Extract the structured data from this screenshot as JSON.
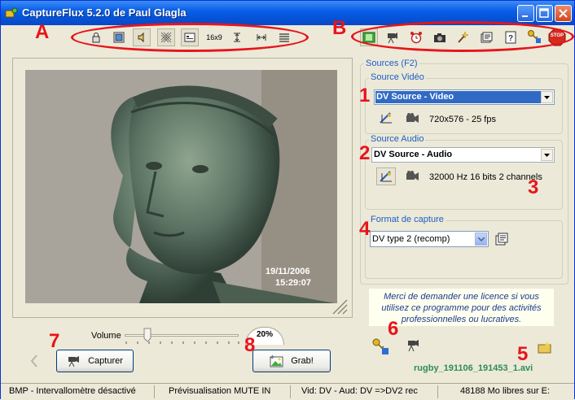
{
  "window": {
    "title": "CaptureFlux 5.2.0 de Paul Glagla"
  },
  "toolbar_a": {
    "icons": [
      "lock-icon",
      "frame-icon",
      "speaker-icon",
      "noise-icon",
      "screen-icon",
      "aspect-16x9",
      "vertical-stretch-icon",
      "horizontal-stretch-icon",
      "lines-icon"
    ],
    "aspect_label": "16x9"
  },
  "toolbar_b": {
    "icons": [
      "film-icon",
      "camera-tripod-icon",
      "alarm-clock-icon",
      "photo-camera-icon",
      "wizard-icon",
      "properties-icon",
      "help-icon",
      "license-key-icon",
      "stop-icon"
    ],
    "stop_label": "STOP"
  },
  "preview": {
    "date": "19/11/2006",
    "time": "15:29:07"
  },
  "sources": {
    "label": "Sources (F2)",
    "video": {
      "label": "Source Vidéo",
      "selected": "DV Source - Video",
      "format": "720x576 - 25 fps"
    },
    "audio": {
      "label": "Source Audio",
      "selected": "DV Source - Audio",
      "format": "32000 Hz 16 bits 2 channels"
    }
  },
  "capture_format": {
    "label": "Format de capture",
    "selected": "DV type 2 (recomp)"
  },
  "license_notice": "Merci de demander une licence si vous utilisez ce programme pour des activités professionnelles ou lucratives.",
  "output_file": "rugby_191106_191453_1.avi",
  "volume": {
    "label": "Volume",
    "percent_label": "20%",
    "level": 0.2
  },
  "buttons": {
    "capture": "Capturer",
    "grab": "Grab!"
  },
  "annotations": {
    "A": "A",
    "B": "B",
    "n1": "1",
    "n2": "2",
    "n3": "3",
    "n4": "4",
    "n5": "5",
    "n6": "6",
    "n7": "7",
    "n8": "8"
  },
  "status": {
    "bmp": "BMP - Intervallomètre désactivé",
    "preview": "Prévisualisation MUTE IN",
    "video": "Vid: DV  - Aud: DV =>DV2 rec",
    "disk": "48188 Mo libres sur E:"
  },
  "colors": {
    "title_bar": "#0A5FE8",
    "annotation_red": "#E8141A",
    "group_label_blue": "#1C5EC7",
    "filename_green": "#2E8B57",
    "window_face": "#ECE9D8"
  }
}
